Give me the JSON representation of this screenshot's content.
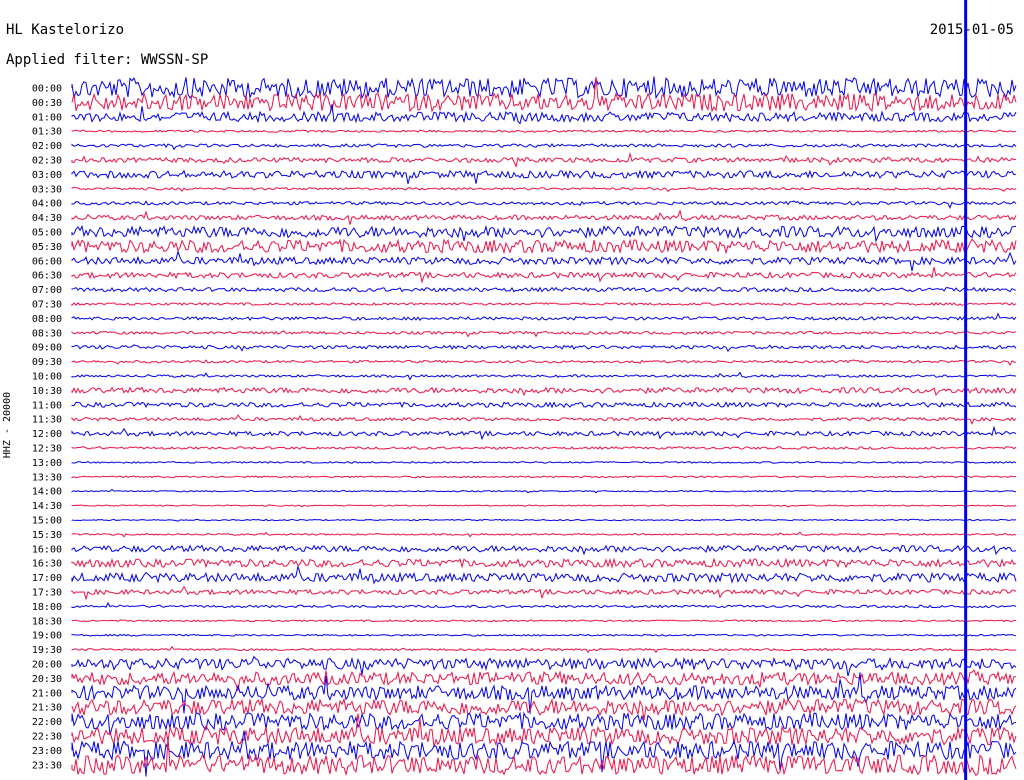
{
  "header": {
    "station": "HL Kastelorizo",
    "filter": "Applied filter: WWSSN-SP",
    "date": "2015-01-05",
    "channel": "HHZ - 20000"
  },
  "colors": {
    "odd_trace": "#0000ee",
    "even_trace": "#ee1144",
    "marker": "#0000ee"
  },
  "chart_data": {
    "type": "line",
    "title": "HL Kastelorizo",
    "subtitle": "Applied filter: WWSSN-SP",
    "ylabel": "HHZ - 20000",
    "y_tick_labels": [
      "00:00",
      "00:30",
      "01:00",
      "01:30",
      "02:00",
      "02:30",
      "03:00",
      "03:30",
      "04:00",
      "04:30",
      "05:00",
      "05:30",
      "06:00",
      "06:30",
      "07:00",
      "07:30",
      "08:00",
      "08:30",
      "09:00",
      "09:30",
      "10:00",
      "10:30",
      "11:00",
      "11:30",
      "12:00",
      "12:30",
      "13:00",
      "13:30",
      "14:00",
      "14:30",
      "15:00",
      "15:30",
      "16:00",
      "16:30",
      "17:00",
      "17:30",
      "18:00",
      "18:30",
      "19:00",
      "19:30",
      "20:00",
      "20:30",
      "21:00",
      "21:30",
      "22:00",
      "22:30",
      "23:00",
      "23:30"
    ],
    "trace_amplitude": [
      2.5,
      2.2,
      1.2,
      0.25,
      0.4,
      0.6,
      0.9,
      0.3,
      0.4,
      0.6,
      1.4,
      1.6,
      0.9,
      0.7,
      0.5,
      0.3,
      0.4,
      0.35,
      0.45,
      0.3,
      0.3,
      0.7,
      0.6,
      0.4,
      0.55,
      0.3,
      0.2,
      0.2,
      0.15,
      0.15,
      0.15,
      0.2,
      0.8,
      1.0,
      1.1,
      0.6,
      0.3,
      0.2,
      0.2,
      0.25,
      1.4,
      1.6,
      1.8,
      2.0,
      2.1,
      2.2,
      2.3,
      2.4
    ],
    "marker_minute": 56.8,
    "grid": false
  }
}
